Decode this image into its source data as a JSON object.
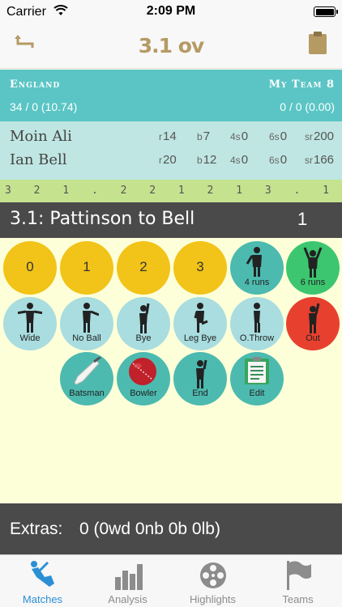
{
  "status_bar": {
    "carrier": "Carrier",
    "time": "2:09 PM"
  },
  "nav": {
    "title": "3.1 ov",
    "back_icon": "back-arrow-icon",
    "right_icon": "clipboard-icon",
    "accent_color": "#b59a64"
  },
  "teams": {
    "batting": {
      "name": "England",
      "score": "34 / 0 (10.74)"
    },
    "bowling": {
      "name": "My Team 8",
      "score": "0 / 0 (0.00)"
    }
  },
  "batsmen": [
    {
      "name": "Moin Ali",
      "r": "14",
      "b": "7",
      "fours": "0",
      "sixes": "0",
      "sr": "200"
    },
    {
      "name": "Ian Bell",
      "r": "20",
      "b": "12",
      "fours": "0",
      "sixes": "0",
      "sr": "166"
    }
  ],
  "stat_keys": {
    "r": "r",
    "b": "b",
    "fours": "4s",
    "sixes": "6s",
    "sr": "sr"
  },
  "over_summary": "3 2 1 . 2 2 1 2 1 3 . 1",
  "current_ball": {
    "description": "3.1: Pattinson to Bell",
    "runs": "1"
  },
  "pad": {
    "row1": [
      {
        "label": "0"
      },
      {
        "label": "1"
      },
      {
        "label": "2"
      },
      {
        "label": "3"
      },
      {
        "label": "4 runs"
      },
      {
        "label": "6 runs"
      }
    ],
    "row2": [
      {
        "label": "Wide"
      },
      {
        "label": "No Ball"
      },
      {
        "label": "Bye"
      },
      {
        "label": "Leg Bye"
      },
      {
        "label": "O.Throw"
      },
      {
        "label": "Out"
      }
    ],
    "row3": [
      {
        "label": "Batsman"
      },
      {
        "label": "Bowler"
      },
      {
        "label": "End"
      },
      {
        "label": "Edit"
      }
    ]
  },
  "extras": {
    "label": "Extras:",
    "value": "0 (0wd 0nb 0b 0lb)"
  },
  "tabs": [
    {
      "label": "Matches",
      "icon": "batsman-icon",
      "active": true
    },
    {
      "label": "Analysis",
      "icon": "bar-chart-icon",
      "active": false
    },
    {
      "label": "Highlights",
      "icon": "film-reel-icon",
      "active": false
    },
    {
      "label": "Teams",
      "icon": "flag-icon",
      "active": false
    }
  ],
  "colors": {
    "teal": "#5bc5c5",
    "yellow": "#f2c318",
    "green": "#3cc66f",
    "red": "#e8402f",
    "active_tab": "#2b8fd6"
  }
}
